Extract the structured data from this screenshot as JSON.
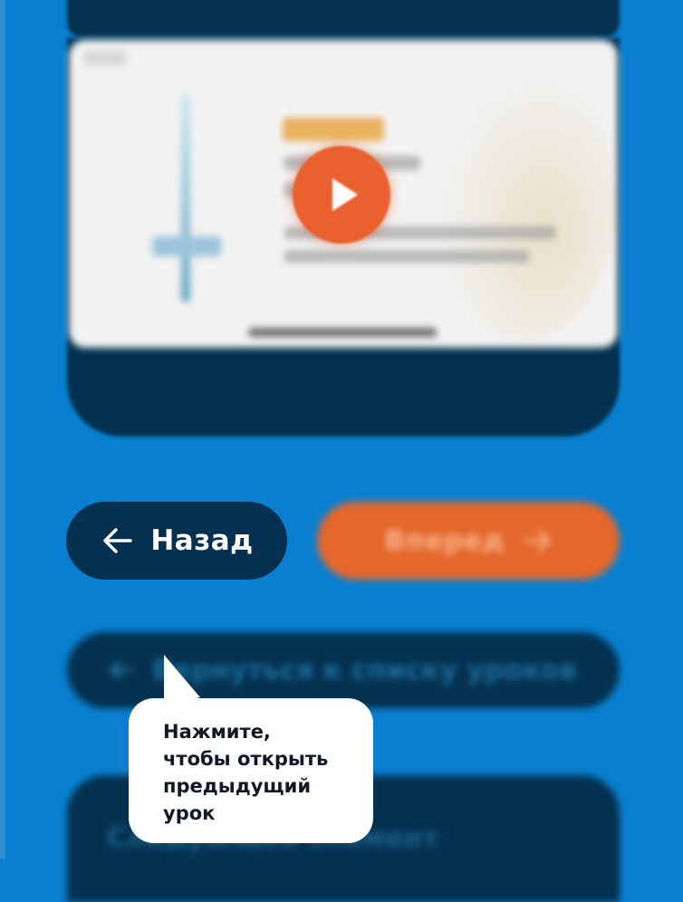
{
  "colors": {
    "background": "#0a7fcf",
    "dark_navy": "#04314f",
    "orange": "#e4672b",
    "white": "#ffffff"
  },
  "video": {
    "play_icon": "play-icon"
  },
  "buttons": {
    "back": {
      "label": "Назад",
      "icon": "arrow-left-icon"
    },
    "forward": {
      "label": "Вперед",
      "icon": "arrow-right-icon"
    },
    "return": {
      "label": "Вернуться к списку уроков",
      "icon": "arrow-left-icon"
    }
  },
  "lower_card": {
    "label": "Следующий элемент"
  },
  "tooltip": {
    "text": "Нажмите,\nчтобы открыть\nпредыдущий\nурок"
  }
}
